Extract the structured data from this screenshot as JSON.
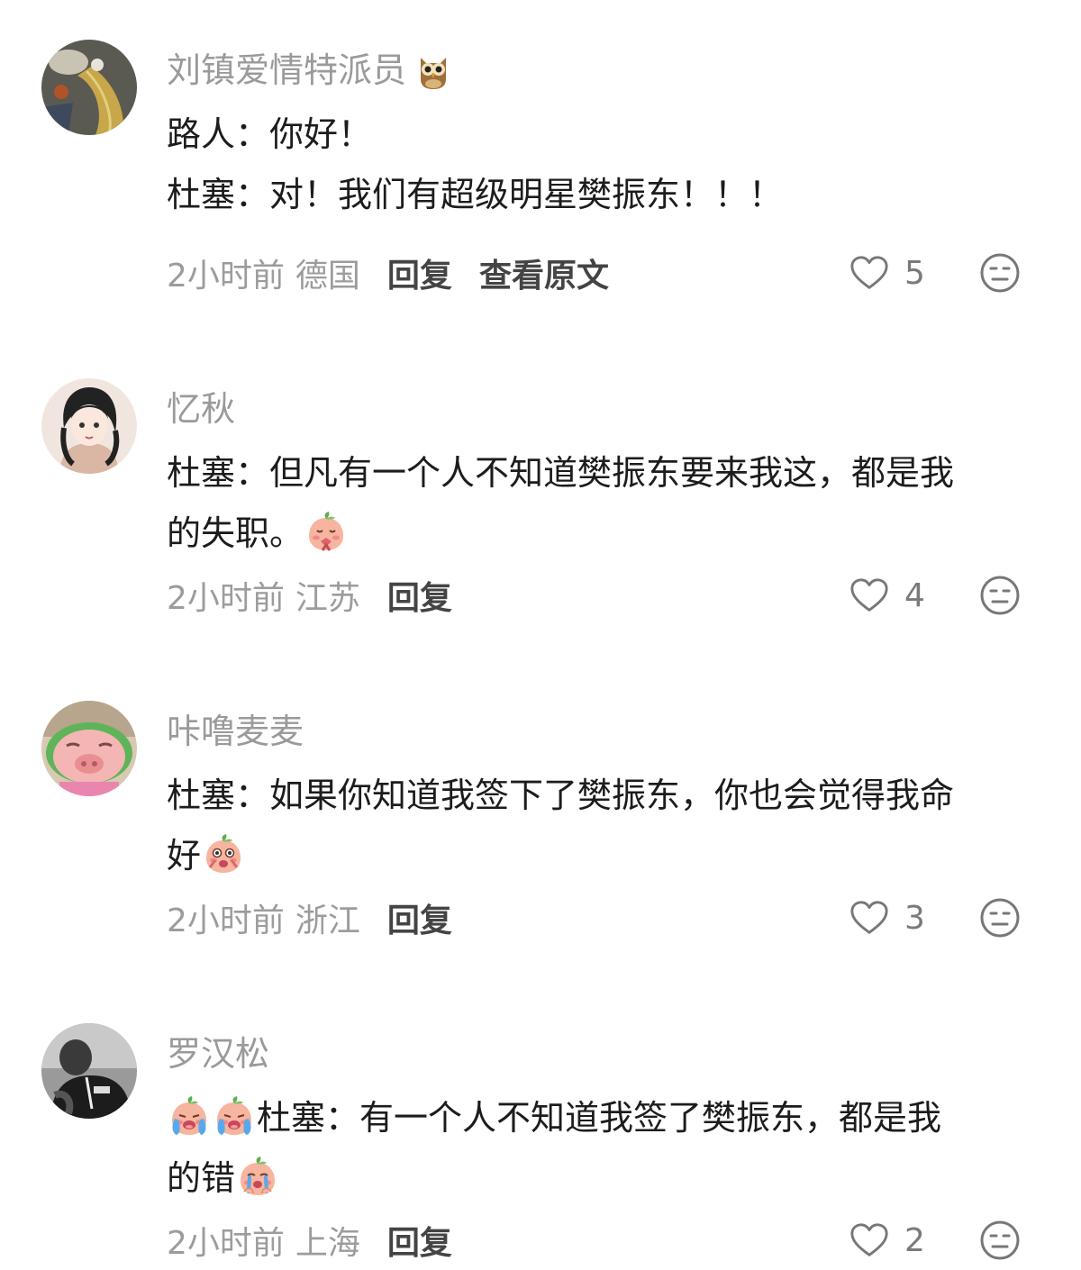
{
  "comments": [
    {
      "username": "刘镇爱情特派员",
      "username_badge": "owl-icon",
      "lines": [
        [
          {
            "t": "text",
            "v": "路人：你好！"
          }
        ],
        [
          {
            "t": "text",
            "v": "杜塞：对！我们有超级明星樊振东！！！"
          }
        ]
      ],
      "time": "2小时前",
      "location": "德国",
      "reply_label": "回复",
      "extra_action": "查看原文",
      "likes": "5"
    },
    {
      "username": "忆秋",
      "lines": [
        [
          {
            "t": "text",
            "v": "杜塞：但凡有一个人不知道樊振东要来我这，都是我"
          }
        ],
        [
          {
            "t": "text",
            "v": "的失职。"
          },
          {
            "t": "emoji",
            "v": "peach-pleading-emoji"
          }
        ]
      ],
      "time": "2小时前",
      "location": "江苏",
      "reply_label": "回复",
      "likes": "4"
    },
    {
      "username": "咔噜麦麦",
      "lines": [
        [
          {
            "t": "text",
            "v": "杜塞：如果你知道我签下了樊振东，你也会觉得我命"
          }
        ],
        [
          {
            "t": "text",
            "v": "好"
          },
          {
            "t": "emoji",
            "v": "peach-shocked-emoji"
          }
        ]
      ],
      "time": "2小时前",
      "location": "浙江",
      "reply_label": "回复",
      "likes": "3"
    },
    {
      "username": "罗汉松",
      "lines": [
        [
          {
            "t": "emoji",
            "v": "peach-crying-emoji"
          },
          {
            "t": "emoji",
            "v": "peach-crying-emoji"
          },
          {
            "t": "text",
            "v": "杜塞：有一个人不知道我签了樊振东，都是我"
          }
        ],
        [
          {
            "t": "text",
            "v": "的错"
          },
          {
            "t": "emoji",
            "v": "peach-sobbing-emoji"
          }
        ]
      ],
      "time": "2小时前",
      "location": "上海",
      "reply_label": "回复",
      "likes": "2"
    }
  ]
}
